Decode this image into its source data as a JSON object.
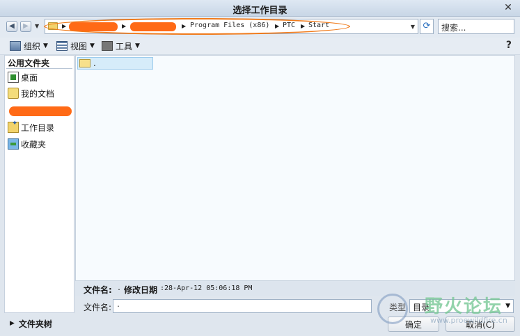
{
  "window": {
    "title": "选择工作目录",
    "close": "✕"
  },
  "address": {
    "segments": [
      "Program Files (x86)",
      "PTC",
      "Start"
    ],
    "search_placeholder": "搜索..."
  },
  "toolbar": {
    "organize": "组织",
    "view": "视图",
    "tools": "工具"
  },
  "sidebar": {
    "header": "公用文件夹",
    "items": [
      "桌面",
      "我的文档",
      "工作目录",
      "收藏夹"
    ]
  },
  "files": [
    {
      "name": "."
    }
  ],
  "details": {
    "name_label": "文件名:",
    "name_value": ".",
    "date_label": "修改日期",
    "date_value": ":28-Apr-12 05:06:18 PM"
  },
  "filename": {
    "label": "文件名:",
    "value": "."
  },
  "type": {
    "label": "类型",
    "value": "目录"
  },
  "folder_tree": "文件夹树",
  "buttons": {
    "ok": "确定",
    "cancel": "取消(C)"
  },
  "watermark": {
    "text": "野火论坛",
    "url": "www.proewildfire.cn"
  }
}
